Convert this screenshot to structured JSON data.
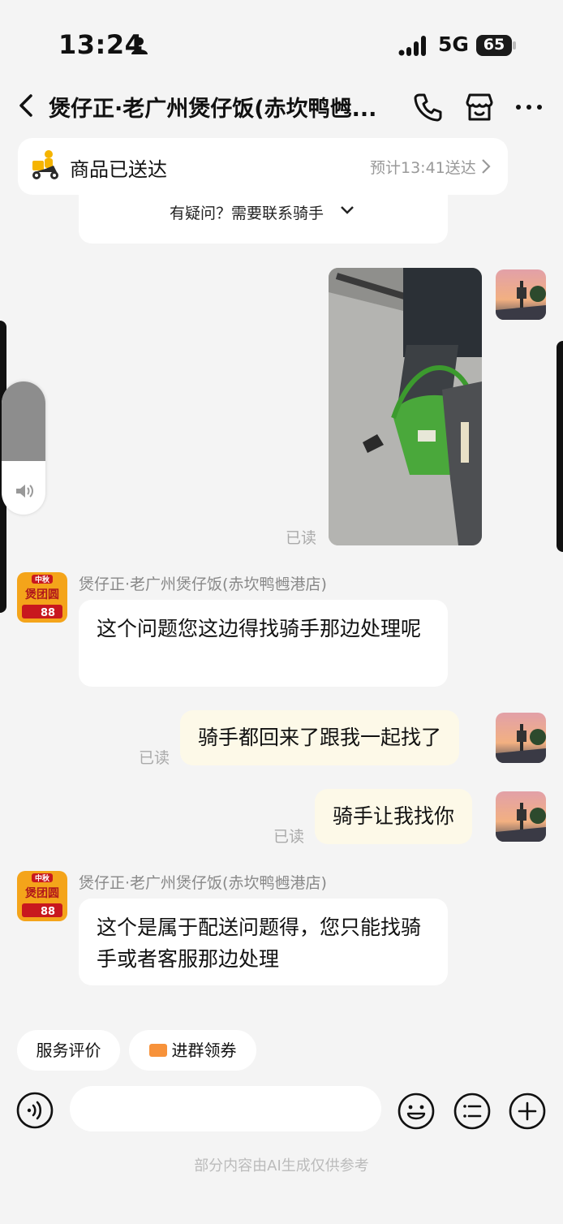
{
  "status_bar": {
    "time": "13:24",
    "network": "5G",
    "battery": "65"
  },
  "nav": {
    "title": "煲仔正·老广州煲仔饭(赤坎鸭乸..."
  },
  "delivery_card": {
    "status": "商品已送达",
    "eta": "预计13:41送达"
  },
  "previous_card": {
    "text": "有疑问？需要联系骑手"
  },
  "messages": [
    {
      "type": "image",
      "side": "right",
      "read_label": "已读"
    },
    {
      "type": "text",
      "side": "left",
      "sender": "煲仔正·老广州煲仔饭(赤坎鸭乸港店)",
      "text": "这个问题您这边得找骑手那边处理呢"
    },
    {
      "type": "text",
      "side": "right",
      "text": "骑手都回来了跟我一起找了",
      "read_label": "已读"
    },
    {
      "type": "text",
      "side": "right",
      "text": "骑手让我找你",
      "read_label": "已读"
    },
    {
      "type": "text",
      "side": "left",
      "sender": "煲仔正·老广州煲仔饭(赤坎鸭乸港店)",
      "text": "这个是属于配送问题得，您只能找骑手或者客服那边处理"
    }
  ],
  "shop_avatar": {
    "top": "中秋",
    "main": "煲团圆",
    "price": "88"
  },
  "quick_actions": [
    {
      "label": "服务评价"
    },
    {
      "label": "进群领券"
    }
  ],
  "input": {
    "placeholder": ""
  },
  "disclaimer": "部分内容由AI生成仅供参考",
  "volume": {
    "level": 0.6
  },
  "icons": [
    "person-icon",
    "signal-icon",
    "battery-icon",
    "back-icon",
    "phone-icon",
    "store-icon",
    "more-icon",
    "rider-icon",
    "chevron-right-icon",
    "volume-icon",
    "voice-icon",
    "emoji-icon",
    "list-icon",
    "plus-icon",
    "coupon-icon"
  ]
}
